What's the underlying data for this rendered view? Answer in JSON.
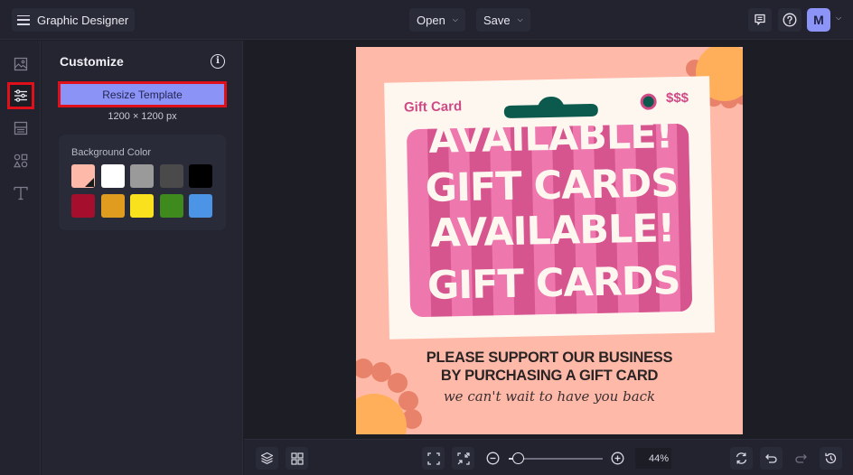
{
  "app": {
    "title": "Graphic Designer",
    "menu_icon": "hamburger-icon"
  },
  "toolbar": {
    "open_label": "Open",
    "save_label": "Save",
    "chevron": "⌄",
    "feedback_icon": "comment-icon",
    "help_icon": "help-circle-icon",
    "avatar_initial": "M"
  },
  "rail": {
    "items": [
      {
        "name": "images",
        "icon": "image-icon",
        "active": false
      },
      {
        "name": "customize",
        "icon": "sliders-icon",
        "active": true
      },
      {
        "name": "layouts",
        "icon": "layout-icon",
        "active": false
      },
      {
        "name": "graphics",
        "icon": "shapes-icon",
        "active": false
      },
      {
        "name": "text",
        "icon": "text-icon",
        "active": false
      }
    ]
  },
  "panel": {
    "title": "Customize",
    "info_glyph": "i",
    "resize_label": "Resize Template",
    "dimensions": "1200 × 1200 px",
    "background_label": "Background Color",
    "swatches": [
      {
        "color": "#ffb9a8",
        "selected": true
      },
      {
        "color": "#ffffff",
        "selected": false
      },
      {
        "color": "#9a9a9a",
        "selected": false
      },
      {
        "color": "#4a4a4a",
        "selected": false
      },
      {
        "color": "#000000",
        "selected": false
      },
      {
        "color": "#a50f2d",
        "selected": false
      },
      {
        "color": "#df9c1e",
        "selected": false
      },
      {
        "color": "#f9e11d",
        "selected": false
      },
      {
        "color": "#3f8a1c",
        "selected": false
      },
      {
        "color": "#4b94e6",
        "selected": false
      }
    ]
  },
  "artboard": {
    "background": "#ffb9a8",
    "card_label": "Gift Card",
    "card_price": "$$$",
    "headline_lines": [
      "AVAILABLE!",
      "GIFT CARDS",
      "AVAILABLE!",
      "GIFT CARDS"
    ],
    "body_line_1": "PLEASE SUPPORT OUR BUSINESS",
    "body_line_2": "BY PURCHASING A GIFT CARD",
    "tagline": "we can't wait to have you back",
    "colors": {
      "card_bg": "#fdf7f0",
      "pink_dark": "#d6558f",
      "pink_light": "#ee77ad",
      "teal": "#0c5a4d",
      "label_pink": "#d04a86",
      "petal": "#e8826a",
      "sun": "#ffae5a",
      "dark_text": "#2a2424"
    }
  },
  "bottombar": {
    "layers_icon": "layers-icon",
    "grid_icon": "grid-icon",
    "fit_icon": "fit-screen-icon",
    "shrink_icon": "shrink-icon",
    "zoom_out_icon": "zoom-out-icon",
    "zoom_in_icon": "zoom-in-icon",
    "zoom_percent": 44,
    "zoom_label": "44%",
    "zoom_slider_fraction": 0.1,
    "replace_icon": "sync-icon",
    "undo_icon": "undo-icon",
    "redo_icon": "redo-icon",
    "history_icon": "history-icon"
  }
}
